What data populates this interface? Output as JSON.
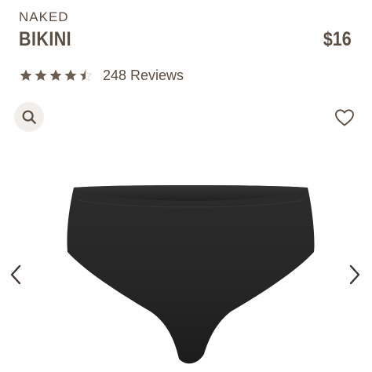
{
  "product": {
    "line": "NAKED",
    "name": "BIKINI",
    "price": "$16"
  },
  "rating": {
    "stars": 4.5,
    "max_stars": 5,
    "reviews_label": "248 Reviews"
  },
  "icons": {
    "search": "search-icon",
    "wishlist": "heart-icon",
    "previous": "chevron-left-icon",
    "next": "chevron-right-icon"
  },
  "colors": {
    "text": "#5a4d41",
    "star": "#6b5d50",
    "search_bg": "#f1eeeb",
    "garment": "#2a2a2a"
  }
}
